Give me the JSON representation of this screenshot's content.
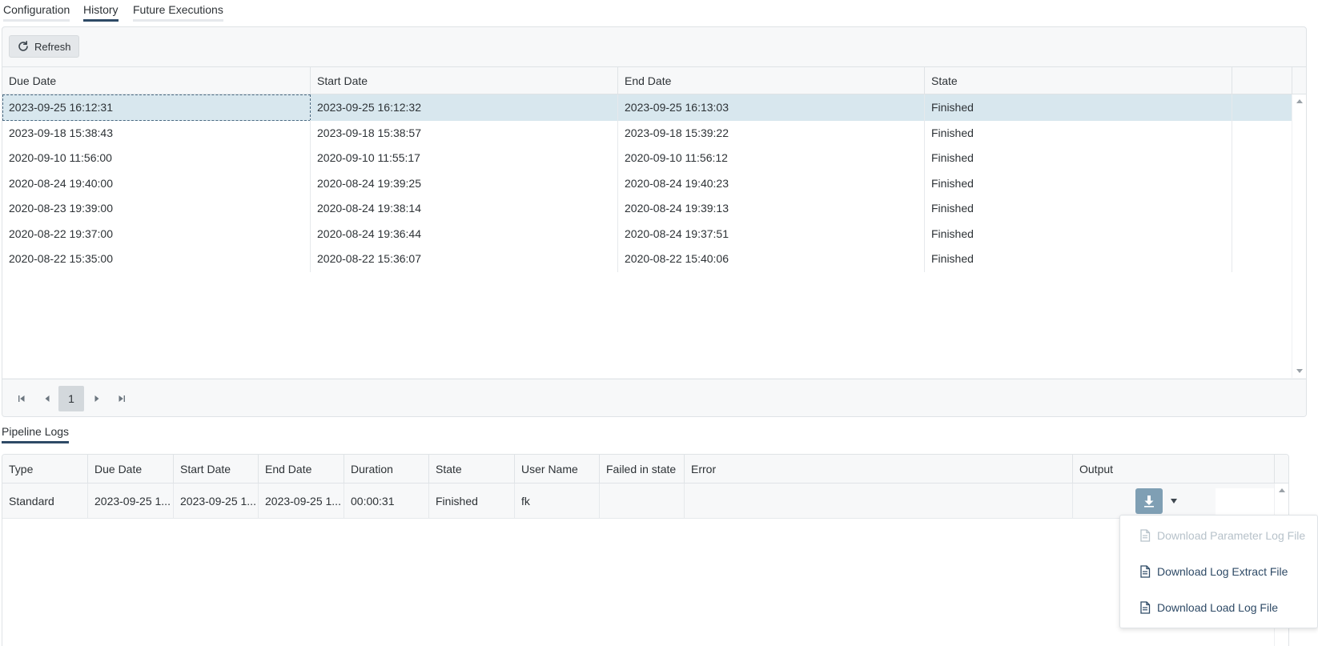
{
  "tabs": [
    {
      "label": "Configuration",
      "active": false
    },
    {
      "label": "History",
      "active": true
    },
    {
      "label": "Future Executions",
      "active": false
    }
  ],
  "history": {
    "refresh_label": "Refresh",
    "columns": [
      "Due Date",
      "Start Date",
      "End Date",
      "State"
    ],
    "rows": [
      [
        "2023-09-25 16:12:31",
        "2023-09-25 16:12:32",
        "2023-09-25 16:13:03",
        "Finished"
      ],
      [
        "2023-09-18 15:38:43",
        "2023-09-18 15:38:57",
        "2023-09-18 15:39:22",
        "Finished"
      ],
      [
        "2020-09-10 11:56:00",
        "2020-09-10 11:55:17",
        "2020-09-10 11:56:12",
        "Finished"
      ],
      [
        "2020-08-24 19:40:00",
        "2020-08-24 19:39:25",
        "2020-08-24 19:40:23",
        "Finished"
      ],
      [
        "2020-08-23 19:39:00",
        "2020-08-24 19:38:14",
        "2020-08-24 19:39:13",
        "Finished"
      ],
      [
        "2020-08-22 19:37:00",
        "2020-08-24 19:36:44",
        "2020-08-24 19:37:51",
        "Finished"
      ],
      [
        "2020-08-22 15:35:00",
        "2020-08-22 15:36:07",
        "2020-08-22 15:40:06",
        "Finished"
      ]
    ],
    "selected_row": 0,
    "current_page": "1"
  },
  "logs": {
    "tab_label": "Pipeline Logs",
    "columns": [
      "Type",
      "Due Date",
      "Start Date",
      "End Date",
      "Duration",
      "State",
      "User Name",
      "Failed in state",
      "Error",
      "Output"
    ],
    "row": {
      "type": "Standard",
      "due_date": "2023-09-25 1...",
      "start_date": "2023-09-25 1...",
      "end_date": "2023-09-25 1...",
      "duration": "00:00:31",
      "state": "Finished",
      "user_name": "fk",
      "failed_in_state": "",
      "error": ""
    }
  },
  "menu": {
    "items": [
      {
        "label": "Download Parameter Log File",
        "disabled": true
      },
      {
        "label": "Download Log Extract File",
        "disabled": false
      },
      {
        "label": "Download Load Log File",
        "disabled": false
      }
    ]
  },
  "colors": {
    "accent": "#2e4a66",
    "selected_row": "#d8e7ee",
    "download_button": "#7f9fb4"
  },
  "icons": {
    "refresh": "refresh-icon",
    "download": "download-icon",
    "file": "file-icon"
  }
}
